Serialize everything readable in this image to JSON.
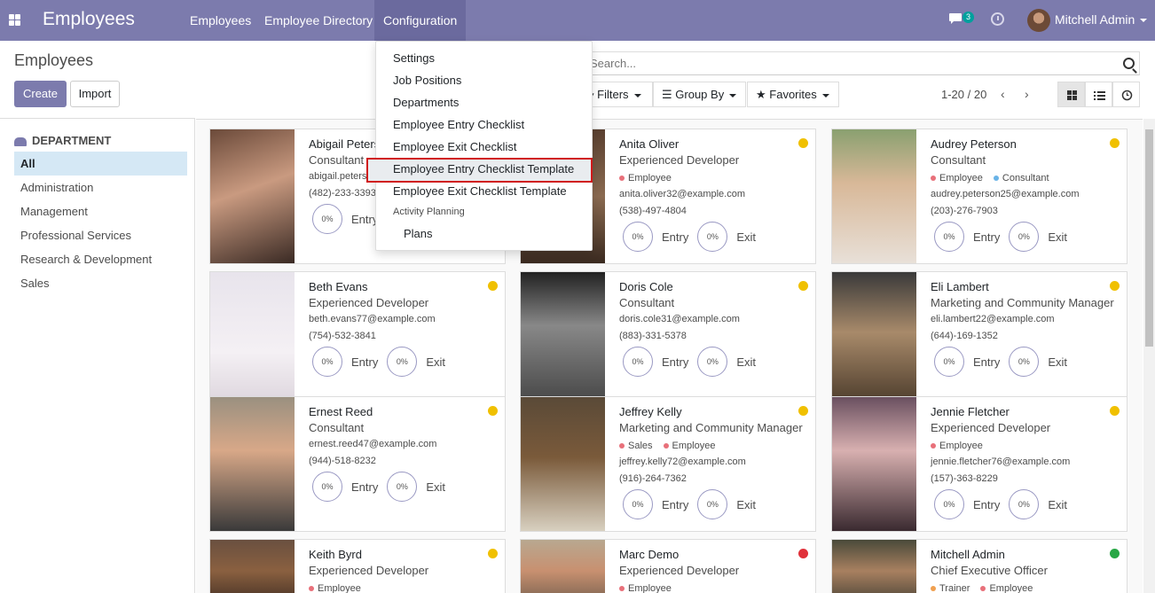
{
  "navbar": {
    "brand": "Employees",
    "menus": [
      "Employees",
      "Employee Directory",
      "Configuration"
    ],
    "chat_count": "3",
    "user_name": "Mitchell Admin"
  },
  "control": {
    "title": "Employees",
    "create": "Create",
    "import": "Import",
    "search_placeholder": "Search...",
    "filters": "Filters",
    "group_by": "Group By",
    "favorites": "Favorites",
    "pager": "1-20 / 20"
  },
  "sidebar": {
    "heading": "DEPARTMENT",
    "items": [
      "All",
      "Administration",
      "Management",
      "Professional Services",
      "Research & Development",
      "Sales"
    ]
  },
  "dropdown": {
    "items": [
      "Settings",
      "Job Positions",
      "Departments",
      "Employee Entry Checklist",
      "Employee Exit Checklist",
      "Employee Entry Checklist Template",
      "Employee Exit Checklist Template"
    ],
    "section": "Activity Planning",
    "sub_items": [
      "Plans"
    ]
  },
  "labels": {
    "entry": "Entry",
    "exit": "Exit",
    "pct": "0%"
  },
  "colors": {
    "tag_employee": "#e8707a",
    "tag_consultant": "#69b3e7",
    "tag_sales": "#e8707a",
    "tag_trainer": "#f0a050",
    "status_yellow": "#f0c000",
    "status_red": "#e0313a",
    "status_green": "#28a745"
  },
  "cards": [
    {
      "name": "Abigail Peterson",
      "job": "Consultant",
      "tags": [],
      "email": "abigail.peterson39@example.com",
      "phone": "(482)-233-3393",
      "status": "yellow"
    },
    {
      "name": "Anita Oliver",
      "job": "Experienced Developer",
      "tags": [
        "Employee"
      ],
      "email": "anita.oliver32@example.com",
      "phone": "(538)-497-4804",
      "status": "yellow"
    },
    {
      "name": "Audrey Peterson",
      "job": "Consultant",
      "tags": [
        "Employee",
        "Consultant"
      ],
      "email": "audrey.peterson25@example.com",
      "phone": "(203)-276-7903",
      "status": "yellow"
    },
    {
      "name": "Beth Evans",
      "job": "Experienced Developer",
      "tags": [],
      "email": "beth.evans77@example.com",
      "phone": "(754)-532-3841",
      "status": "yellow"
    },
    {
      "name": "Doris Cole",
      "job": "Consultant",
      "tags": [],
      "email": "doris.cole31@example.com",
      "phone": "(883)-331-5378",
      "status": "yellow"
    },
    {
      "name": "Eli Lambert",
      "job": "Marketing and Community Manager",
      "tags": [],
      "email": "eli.lambert22@example.com",
      "phone": "(644)-169-1352",
      "status": "yellow"
    },
    {
      "name": "Ernest Reed",
      "job": "Consultant",
      "tags": [],
      "email": "ernest.reed47@example.com",
      "phone": "(944)-518-8232",
      "status": "yellow"
    },
    {
      "name": "Jeffrey Kelly",
      "job": "Marketing and Community Manager",
      "tags": [
        "Sales",
        "Employee"
      ],
      "email": "jeffrey.kelly72@example.com",
      "phone": "(916)-264-7362",
      "status": "yellow"
    },
    {
      "name": "Jennie Fletcher",
      "job": "Experienced Developer",
      "tags": [
        "Employee"
      ],
      "email": "jennie.fletcher76@example.com",
      "phone": "(157)-363-8229",
      "status": "yellow"
    },
    {
      "name": "Keith Byrd",
      "job": "Experienced Developer",
      "tags": [
        "Employee"
      ],
      "email": "",
      "phone": "",
      "status": "yellow"
    },
    {
      "name": "Marc Demo",
      "job": "Experienced Developer",
      "tags": [
        "Employee"
      ],
      "email": "",
      "phone": "",
      "status": "red"
    },
    {
      "name": "Mitchell Admin",
      "job": "Chief Executive Officer",
      "tags": [
        "Trainer",
        "Employee"
      ],
      "email": "",
      "phone": "",
      "status": "green"
    }
  ]
}
